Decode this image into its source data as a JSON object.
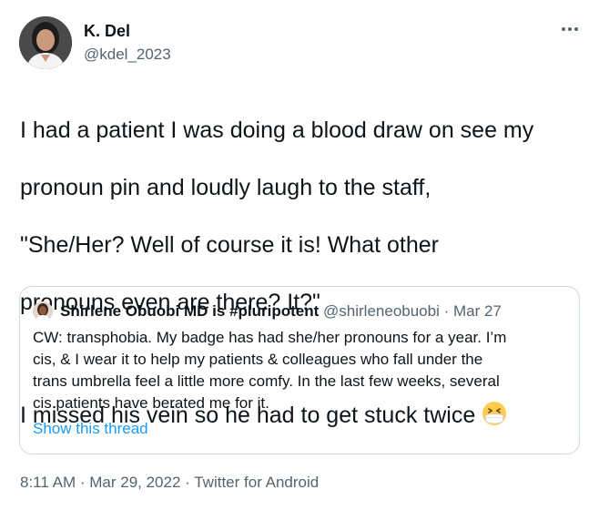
{
  "author": {
    "name": "K. Del",
    "handle": "@kdel_2023"
  },
  "tweet": {
    "lines": [
      "I had a patient I was doing a blood draw on see my",
      "pronoun pin and loudly laugh to the staff,",
      "\"She/Her? Well of course it is! What other",
      "pronouns even are there? It?\""
    ],
    "final_line": "I missed his vein so he had to get stuck twice",
    "emoji": "face-with-medical-mask-icon"
  },
  "quote": {
    "name": "Shirlene Obuobi MD is #pluripotent",
    "handle_date": "@shirleneobuobi · Mar 27",
    "lines": [
      "CW: transphobia. My badge has had she/her pronouns for a year. I’m",
      "cis, & I wear it to help  my patients & colleagues who fall under the",
      "trans umbrella feel a little more comfy. In the last few weeks, several",
      "cis patients have berated me for it."
    ],
    "show_thread": "Show this thread"
  },
  "meta": {
    "time": "8:11 AM",
    "date": "Mar 29, 2022",
    "source": "Twitter for Android",
    "separator": " · "
  },
  "colors": {
    "text": "#0f1419",
    "secondary": "#536471",
    "link": "#1d9bf0",
    "border": "#cfd9de"
  }
}
